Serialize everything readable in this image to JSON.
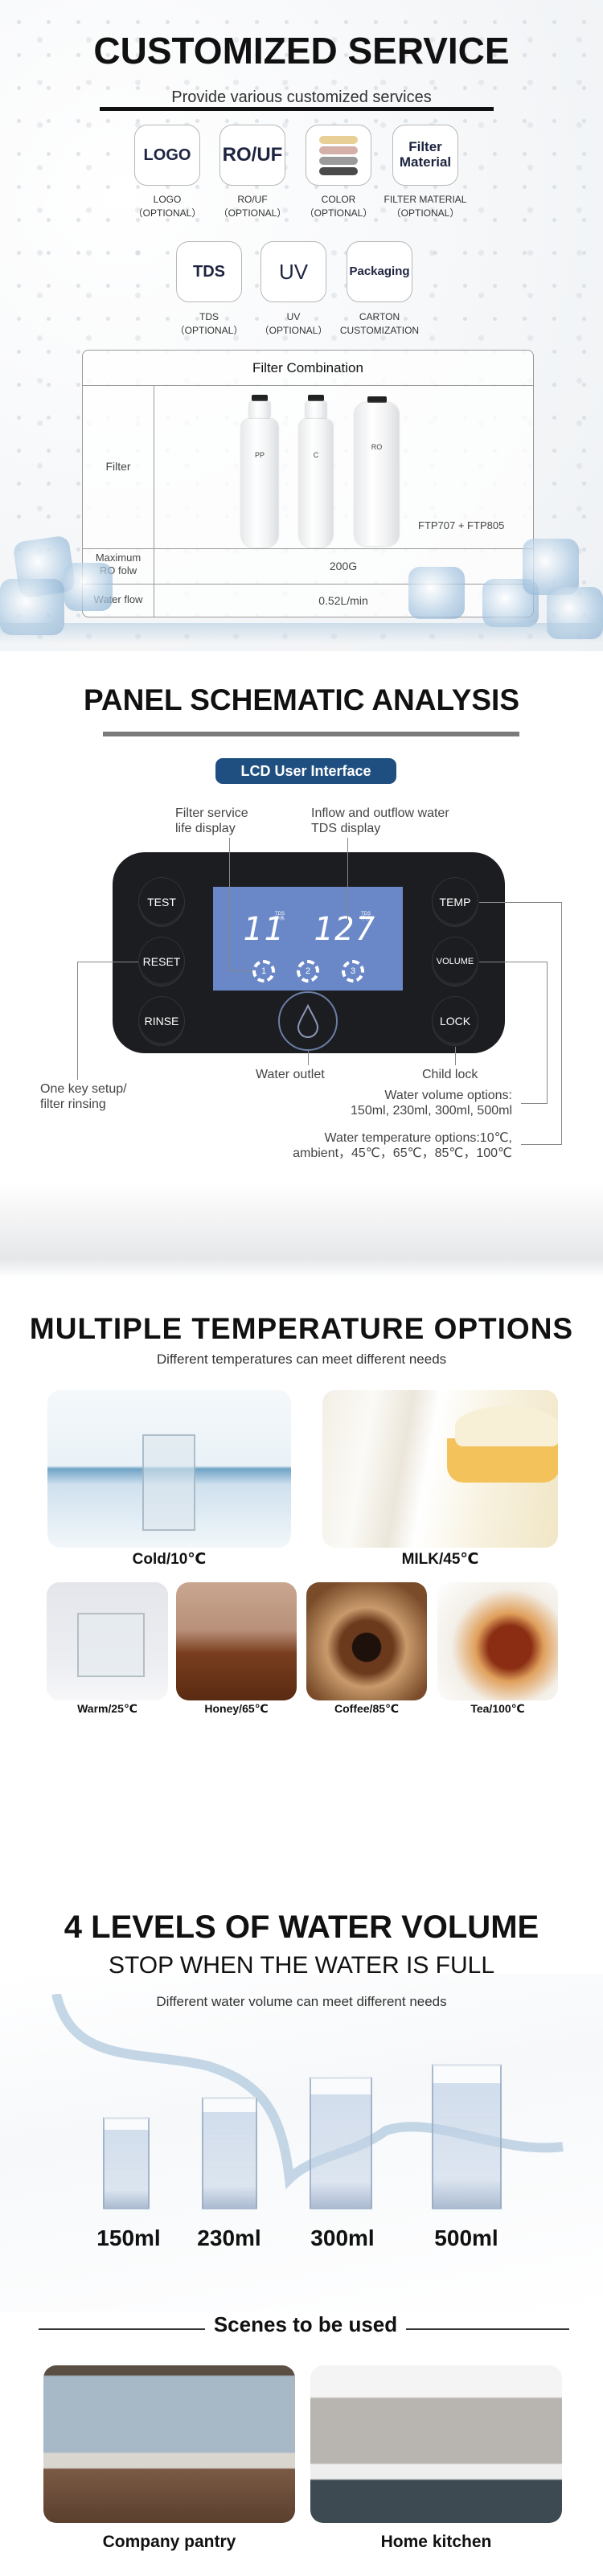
{
  "customized": {
    "title": "CUSTOMIZED SERVICE",
    "subtitle": "Provide various customized services",
    "options": [
      {
        "icon_text": "LOGO",
        "label1": "LOGO",
        "label2": "（OPTIONAL）"
      },
      {
        "icon_text": "RO/UF",
        "label1": "RO/UF",
        "label2": "（OPTIONAL）"
      },
      {
        "icon": "color-swatches-icon",
        "label1": "COLOR",
        "label2": "（OPTIONAL）",
        "swatches": [
          "#e8cf95",
          "#d4b0a8",
          "#9b9b9b",
          "#4a4a4a"
        ]
      },
      {
        "icon_text": "Filter Material",
        "label1": "FILTER MATERIAL",
        "label2": "（OPTIONAL）"
      },
      {
        "icon_text": "TDS",
        "label1": "TDS",
        "label2": "（OPTIONAL）"
      },
      {
        "icon_text": "UV",
        "label1": "UV",
        "label2": "（OPTIONAL）"
      },
      {
        "icon_text": "Packaging",
        "label1": "CARTON",
        "label2": "CUSTOMIZATION"
      }
    ]
  },
  "filter_table": {
    "header": "Filter Combination",
    "rows": [
      {
        "label": "Filter",
        "value": "FTP707 + FTP805"
      },
      {
        "label": "Maximum RO folw",
        "value": "200G"
      },
      {
        "label": "Water flow",
        "value": "0.52L/min"
      }
    ],
    "cartridges": [
      "PP",
      "C",
      "RO"
    ]
  },
  "panel": {
    "title": "PANEL SCHEMATIC ANALYSIS",
    "badge": "LCD User Interface",
    "badge_color": "#1e4f80",
    "buttons_left": [
      "TEST",
      "RESET",
      "RINSE"
    ],
    "buttons_right": [
      "TEMP",
      "VOLUME",
      "LOCK"
    ],
    "lcd": {
      "left_value": "11",
      "right_value": "127",
      "tds_tag": "TDS",
      "water_tag": "净水",
      "filters": [
        "1",
        "2",
        "3"
      ],
      "color": "#6a88c8"
    },
    "annotations": {
      "filter_life": "Filter service life display",
      "tds": "Inflow and outflow water TDS display",
      "outlet": "Water outlet",
      "child_lock": "Child lock",
      "rinse": "One key setup/ filter rinsing",
      "volume_1": "Water volume options:",
      "volume_2": "150ml, 230ml, 300ml, 500ml",
      "temp_1": "Water temperature options:10℃,",
      "temp_2": "ambient，45℃，65℃，85℃，100℃"
    }
  },
  "temperature": {
    "title": "MULTIPLE TEMPERATURE OPTIONS",
    "subtitle": "Different temperatures can meet different needs",
    "large": [
      "Cold/10℃",
      "MILK/45℃"
    ],
    "small": [
      "Warm/25℃",
      "Honey/65℃",
      "Coffee/85℃",
      "Tea/100℃"
    ]
  },
  "volume": {
    "title": "4 LEVELS OF WATER VOLUME",
    "subtitle": "STOP WHEN THE WATER IS FULL",
    "caption": "Different water volume can meet different needs",
    "levels": [
      "150ml",
      "230ml",
      "300ml",
      "500ml"
    ]
  },
  "scenes": {
    "title": "Scenes to be used",
    "items": [
      "Company pantry",
      "Home kitchen"
    ]
  }
}
